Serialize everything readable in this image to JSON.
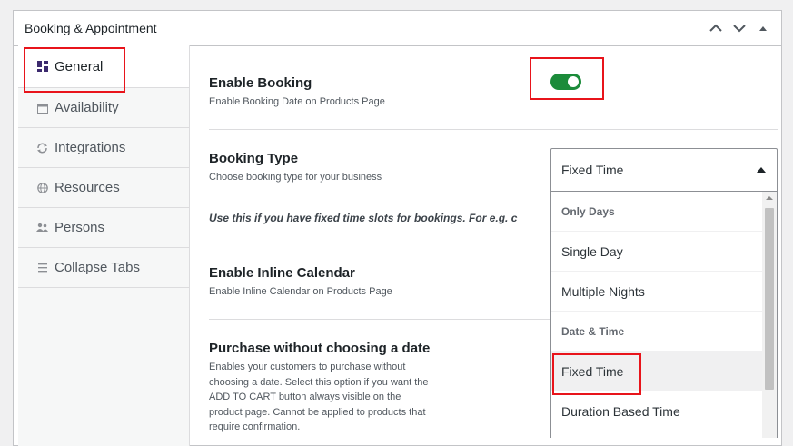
{
  "panel": {
    "title": "Booking & Appointment"
  },
  "sidebar": {
    "tabs": [
      {
        "label": "General",
        "icon": "dashboard-icon"
      },
      {
        "label": "Availability",
        "icon": "calendar-icon"
      },
      {
        "label": "Integrations",
        "icon": "sync-icon"
      },
      {
        "label": "Resources",
        "icon": "globe-icon"
      },
      {
        "label": "Persons",
        "icon": "people-icon"
      },
      {
        "label": "Collapse Tabs",
        "icon": "menu-icon"
      }
    ]
  },
  "settings": {
    "enable_booking": {
      "title": "Enable Booking",
      "desc": "Enable Booking Date on Products Page",
      "enabled": true
    },
    "booking_type": {
      "title": "Booking Type",
      "desc": "Choose booking type for your business",
      "selected": "Fixed Time",
      "note": "Use this if you have fixed time slots for bookings. For e.g. c"
    },
    "inline_calendar": {
      "title": "Enable Inline Calendar",
      "desc": "Enable Inline Calendar on Products Page"
    },
    "purchase_without_date": {
      "title": "Purchase without choosing a date",
      "desc": "Enables your customers to purchase without choosing a date. Select this option if you want the ADD TO CART button always visible on the product page. Cannot be applied to products that require confirmation."
    }
  },
  "dropdown": {
    "groups": [
      {
        "label": "Only Days",
        "options": [
          "Single Day",
          "Multiple Nights"
        ]
      },
      {
        "label": "Date & Time",
        "options": [
          "Fixed Time",
          "Duration Based Time"
        ]
      }
    ]
  },
  "colors": {
    "toggle_on": "#1b8b3a",
    "highlight": "#e8141b",
    "active_icon": "#3c2a6e"
  }
}
